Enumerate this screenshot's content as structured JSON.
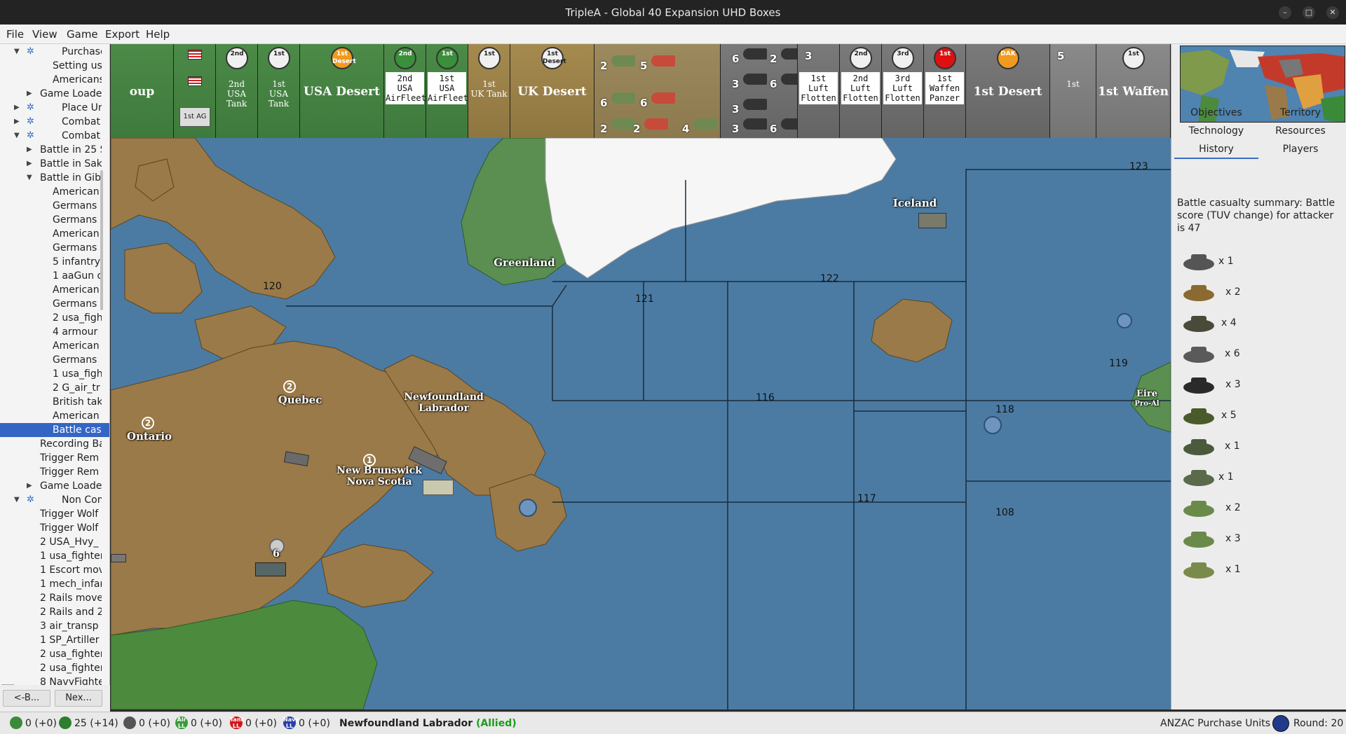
{
  "window": {
    "title": "TripleA - Global 40 Expansion UHD Boxes"
  },
  "menu": [
    "File",
    "View",
    "Game",
    "Export",
    "Help"
  ],
  "tree": [
    {
      "label": "Purchase Un",
      "depth": 0,
      "arrow": "down",
      "star": true
    },
    {
      "label": "Setting uses",
      "depth": 2
    },
    {
      "label": "Americans b",
      "depth": 2
    },
    {
      "label": "Game Loade",
      "depth": 1,
      "arrow": "right"
    },
    {
      "label": "Place Units",
      "depth": 0,
      "arrow": "right",
      "star": true
    },
    {
      "label": "Combat Move",
      "depth": 0,
      "arrow": "right",
      "star": true
    },
    {
      "label": "Combat",
      "depth": 0,
      "arrow": "down",
      "star": true
    },
    {
      "label": "Battle in 25 S",
      "depth": 1,
      "arrow": "right"
    },
    {
      "label": "Battle in Sakl",
      "depth": 1,
      "arrow": "right"
    },
    {
      "label": "Battle in Gibr",
      "depth": 1,
      "arrow": "down"
    },
    {
      "label": "American",
      "depth": 2
    },
    {
      "label": "Germans",
      "depth": 2
    },
    {
      "label": "Germans",
      "depth": 2
    },
    {
      "label": "American",
      "depth": 2
    },
    {
      "label": "Germans",
      "depth": 2
    },
    {
      "label": "5 infantry",
      "depth": 2
    },
    {
      "label": "1 aaGun o",
      "depth": 2
    },
    {
      "label": "American",
      "depth": 2
    },
    {
      "label": "Germans",
      "depth": 2
    },
    {
      "label": "2 usa_figh",
      "depth": 2
    },
    {
      "label": "4 armour",
      "depth": 2
    },
    {
      "label": "American",
      "depth": 2
    },
    {
      "label": "Germans",
      "depth": 2
    },
    {
      "label": "1 usa_figh",
      "depth": 2
    },
    {
      "label": "2 G_air_tr",
      "depth": 2
    },
    {
      "label": "British tak",
      "depth": 2
    },
    {
      "label": "American",
      "depth": 2
    },
    {
      "label": "Battle cas",
      "depth": 2,
      "selected": true
    },
    {
      "label": "Recording Ba",
      "depth": 1
    },
    {
      "label": "Trigger Rem",
      "depth": 1
    },
    {
      "label": "Trigger Rem",
      "depth": 1
    },
    {
      "label": "Game Loade",
      "depth": 1,
      "arrow": "right"
    },
    {
      "label": "Non Combat",
      "depth": 0,
      "arrow": "down",
      "star": true
    },
    {
      "label": "Trigger Wolf",
      "depth": 1
    },
    {
      "label": "Trigger Wolf",
      "depth": 1
    },
    {
      "label": "2 USA_Hvy_",
      "depth": 1
    },
    {
      "label": "1 usa_fighter",
      "depth": 1
    },
    {
      "label": "1 Escort mov",
      "depth": 1
    },
    {
      "label": "1 mech_infar",
      "depth": 1
    },
    {
      "label": "2 Rails move",
      "depth": 1
    },
    {
      "label": "2 Rails and 2",
      "depth": 1
    },
    {
      "label": "3 air_transp",
      "depth": 1
    },
    {
      "label": "1 SP_Artiller",
      "depth": 1
    },
    {
      "label": "2 usa_fighter",
      "depth": 1
    },
    {
      "label": "2 usa_fighter",
      "depth": 1
    },
    {
      "label": "8 NavyFighte",
      "depth": 1
    }
  ],
  "nav": {
    "back": "<-B...",
    "next": "Nex..."
  },
  "unitbar": {
    "cells": [
      {
        "id": "c0",
        "style": "green",
        "big": "oup"
      },
      {
        "id": "c1",
        "style": "green",
        "badge_label": "1st AG"
      },
      {
        "id": "c2",
        "style": "green",
        "badge": "2nd",
        "small": "2nd\nUSA Tank"
      },
      {
        "id": "c3",
        "style": "green",
        "badge": "1st",
        "small": "1st\nUSA Tank"
      },
      {
        "id": "c4",
        "style": "green",
        "badge": "1st\nDesert",
        "big": "USA Desert"
      },
      {
        "id": "c5",
        "style": "green",
        "badge": "2nd",
        "box": "2nd\nUSA\nAirFleet"
      },
      {
        "id": "c6",
        "style": "green",
        "badge": "1st",
        "box": "1st\nUSA\nAirFleet"
      },
      {
        "id": "c7",
        "style": "desert",
        "badge": "1st",
        "small": "1st\nUK Tank"
      },
      {
        "id": "c8",
        "style": "desert",
        "badge": "1st\nDesert",
        "big": "UK Desert"
      },
      {
        "id": "c9",
        "style": "desertlt",
        "counts": [
          "2",
          "5",
          "6",
          "6",
          "2",
          "2",
          "4"
        ]
      },
      {
        "id": "c10",
        "style": "grey",
        "counts": [
          "6",
          "2",
          "3",
          "6",
          "3",
          "3",
          "6"
        ]
      },
      {
        "id": "c11",
        "style": "grey",
        "count": "3",
        "box": "1st\nLuft\nFlotten"
      },
      {
        "id": "c12",
        "style": "grey",
        "badge": "2nd",
        "box": "2nd\nLuft\nFlotten"
      },
      {
        "id": "c13",
        "style": "grey",
        "badge": "3rd",
        "box": "3rd\nLuft\nFlotten"
      },
      {
        "id": "c14",
        "style": "grey",
        "badge": "1st",
        "box": "1st\nWaffen\nPanzer"
      },
      {
        "id": "c15",
        "style": "grey",
        "badge": "DAK",
        "big": "1st Desert"
      },
      {
        "id": "c16",
        "style": "greylt",
        "count": "5",
        "small": "1st"
      },
      {
        "id": "c17",
        "style": "greylt",
        "badge": "1st",
        "big": "1st Waffen"
      }
    ]
  },
  "map": {
    "labels": [
      {
        "id": "greenland",
        "text": "Greenland"
      },
      {
        "id": "iceland",
        "text": "Iceland"
      },
      {
        "id": "quebec",
        "text": "Quebec"
      },
      {
        "id": "ontario",
        "text": "Ontario"
      },
      {
        "id": "newfoundland",
        "text": "Newfoundland\nLabrador"
      },
      {
        "id": "newbrunswick",
        "text": "New Brunswick\nNova Scotia"
      },
      {
        "id": "eire",
        "text": "Eire"
      },
      {
        "id": "proallied",
        "text": "Pro-Al"
      }
    ],
    "production": {
      "quebec": "2",
      "ontario": "2",
      "newbrunswick": "1"
    },
    "sea_zones": [
      "123",
      "122",
      "121",
      "120",
      "116",
      "119",
      "118",
      "117",
      "108"
    ],
    "stack_count": "6"
  },
  "right": {
    "tabs": [
      "Objectives",
      "Territory",
      "Technology",
      "Resources",
      "History",
      "Players"
    ],
    "active_tab": "History",
    "summary": "Battle casualty summary: Battle score (TUV change) for attacker is 47",
    "casualties": [
      {
        "unit": "aa-gun",
        "count": "x 1"
      },
      {
        "unit": "air-transport",
        "count": "x 2"
      },
      {
        "unit": "infantry",
        "count": "x 4"
      },
      {
        "unit": "tank",
        "count": "x 6"
      },
      {
        "unit": "fighter",
        "count": "x 3"
      },
      {
        "unit": "soldier",
        "count": "x 5"
      },
      {
        "unit": "artillery",
        "count": "x 1"
      },
      {
        "unit": "officer",
        "count": "x 1"
      },
      {
        "unit": "tactical-bomber",
        "count": "x 2"
      },
      {
        "unit": "fighter-green",
        "count": "x 3"
      },
      {
        "unit": "fighter-orange",
        "count": "x 1"
      }
    ]
  },
  "status": {
    "items": [
      {
        "id": "pus",
        "text": "0 (+0)",
        "color": "#3b8a3b"
      },
      {
        "id": "money",
        "text": "25 (+14)",
        "color": "#2f7d2f"
      },
      {
        "id": "tech",
        "text": "0 (+0)",
        "color": "#555555"
      },
      {
        "id": "airll",
        "text": "0 (+0)",
        "label": "Air LL",
        "color": "#3a9a3a"
      },
      {
        "id": "tankll",
        "text": "0 (+0)",
        "label": "Tank LL",
        "color": "#d01818"
      },
      {
        "id": "navyll",
        "text": "0 (+0)",
        "label": "Navy LL",
        "color": "#2640a8"
      }
    ],
    "territory": "Newfoundland Labrador",
    "territory_owner": "(Allied)",
    "phase": "ANZAC Purchase Units",
    "round": "Round: 20"
  }
}
